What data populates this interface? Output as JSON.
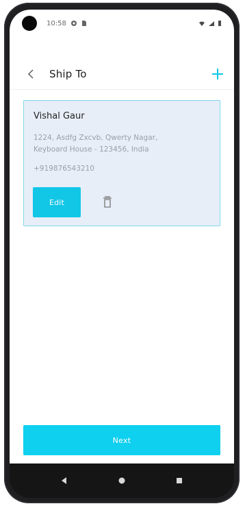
{
  "status_bar": {
    "time": "10:58",
    "icons_left": [
      "settings-icon",
      "sd-card-icon"
    ],
    "icons_right": [
      "wifi-icon",
      "signal-icon",
      "battery-icon"
    ]
  },
  "header": {
    "title": "Ship To",
    "back_icon": "back-icon",
    "add_icon": "add-icon"
  },
  "address_card": {
    "name": "Vishal Gaur",
    "address_line_1": "1224, Asdfg Zxcvb, Qwerty Nagar,",
    "address_line_2": "Keyboard House - 123456, India",
    "phone": "+919876543210",
    "edit_label": "Edit",
    "delete_icon": "trash-icon"
  },
  "footer": {
    "next_label": "Next"
  },
  "navigation": {
    "buttons": [
      "back-triangle-icon",
      "home-dot-icon",
      "recents-square-icon"
    ]
  },
  "colors": {
    "accent": "#12c6e6",
    "card_background": "#e7eef8",
    "card_border": "#7fd7ea"
  }
}
